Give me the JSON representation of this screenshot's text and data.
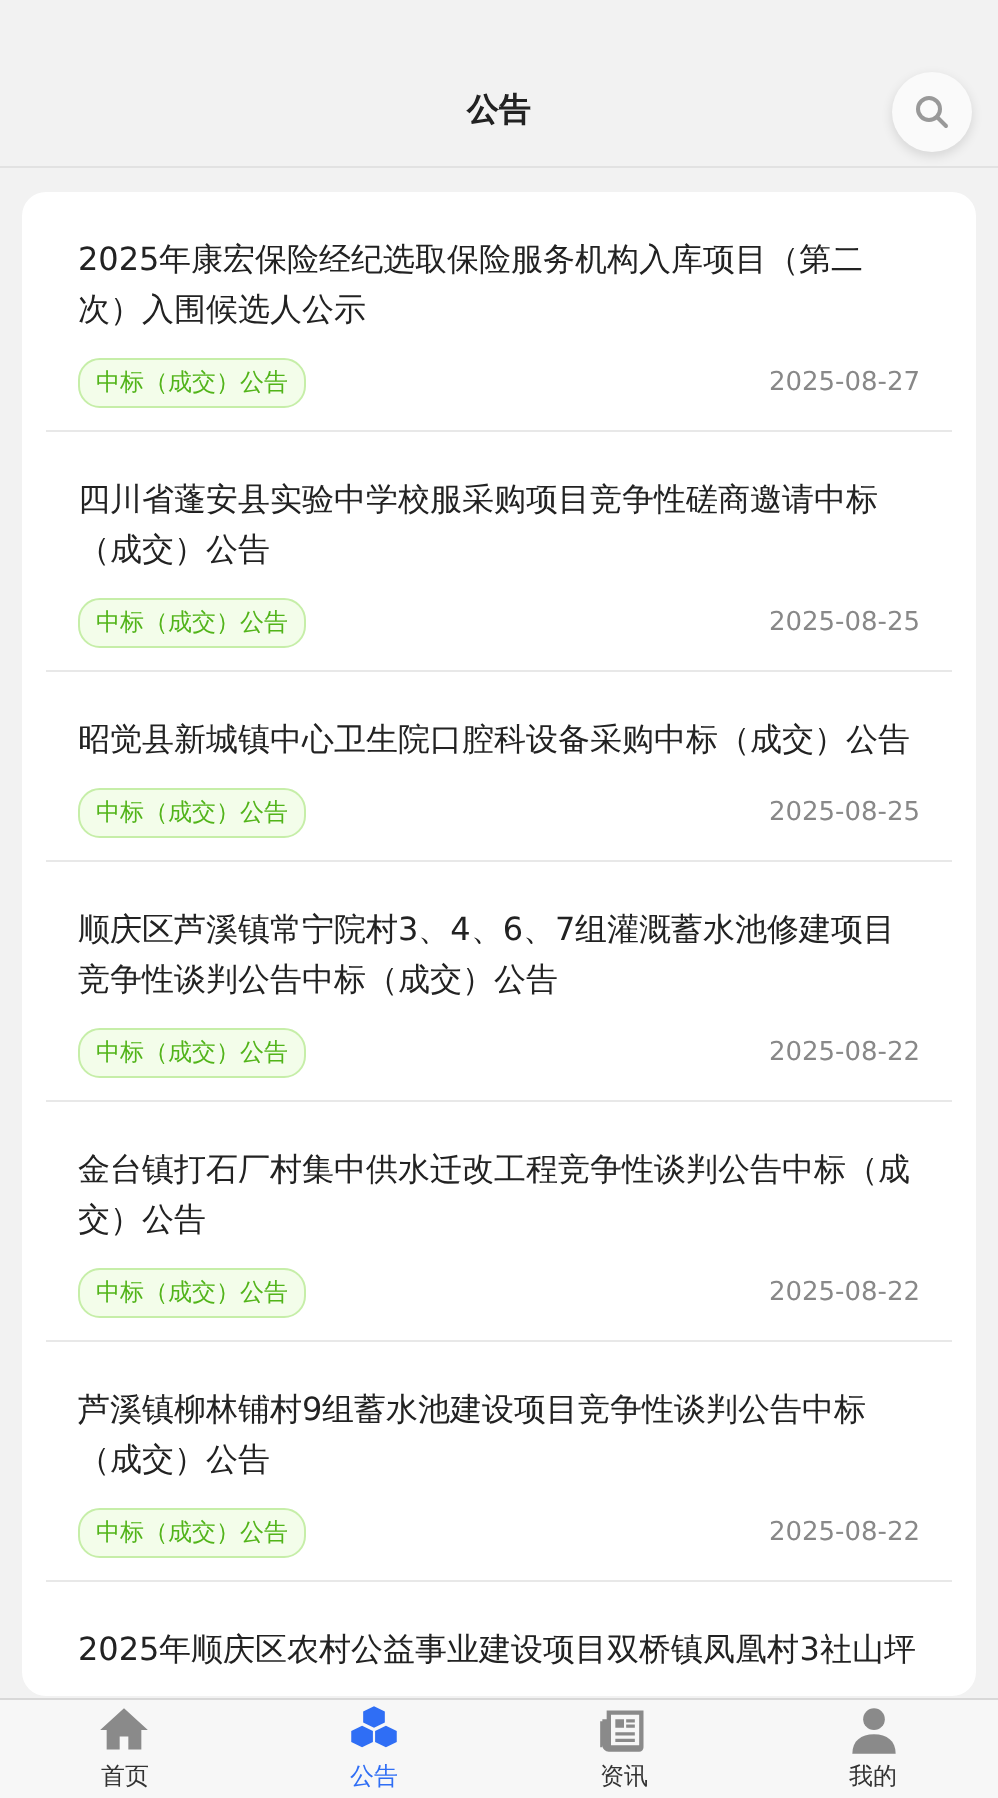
{
  "header": {
    "title": "公告"
  },
  "notices": [
    {
      "title": "2025年康宏保险经纪选取保险服务机构入库项目（第二次）入围候选人公示",
      "tag": "中标（成交）公告",
      "date": "2025-08-27"
    },
    {
      "title": "四川省蓬安县实验中学校服采购项目竞争性磋商邀请中标（成交）公告",
      "tag": "中标（成交）公告",
      "date": "2025-08-25"
    },
    {
      "title": "昭觉县新城镇中心卫生院口腔科设备采购中标（成交）公告",
      "tag": "中标（成交）公告",
      "date": "2025-08-25"
    },
    {
      "title": "顺庆区芦溪镇常宁院村3、4、6、7组灌溉蓄水池修建项目竞争性谈判公告中标（成交）公告",
      "tag": "中标（成交）公告",
      "date": "2025-08-22"
    },
    {
      "title": "金台镇打石厂村集中供水迁改工程竞争性谈判公告中标（成交）公告",
      "tag": "中标（成交）公告",
      "date": "2025-08-22"
    },
    {
      "title": "芦溪镇柳林铺村9组蓄水池建设项目竞争性谈判公告中标（成交）公告",
      "tag": "中标（成交）公告",
      "date": "2025-08-22"
    },
    {
      "title": "2025年顺庆区农村公益事业建设项目双桥镇凤凰村3社山坪"
    }
  ],
  "tabs": [
    {
      "label": "首页",
      "selected": false
    },
    {
      "label": "公告",
      "selected": true
    },
    {
      "label": "资讯",
      "selected": false
    },
    {
      "label": "我的",
      "selected": false
    }
  ]
}
